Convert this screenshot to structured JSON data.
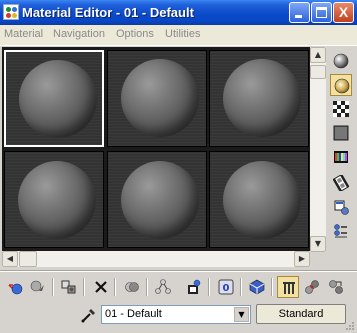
{
  "window": {
    "title": "Material Editor - 01 - Default",
    "minimize_glyph": "_",
    "maximize_glyph": "□",
    "close_glyph": "X"
  },
  "menu": {
    "items": [
      "Material",
      "Navigation",
      "Options",
      "Utilities"
    ],
    "text_color": "#8a8a8a"
  },
  "sample_slots": {
    "count": 6,
    "active_index": 0
  },
  "right_toolbar": {
    "icons": [
      "sample-type-sphere-icon",
      "backlight-icon",
      "background-checker-icon",
      "sample-uv-tiling-icon",
      "video-color-check-icon",
      "make-preview-icon",
      "options-icon",
      "select-by-material-icon"
    ],
    "selected_index": 1
  },
  "bottom_toolbar": {
    "icons": [
      "get-material-icon",
      "put-to-scene-icon",
      "assign-to-selection-icon",
      "reset-material-icon",
      "make-copy-icon",
      "make-unique-icon",
      "put-to-library-icon",
      "material-effects-channel-icon",
      "show-in-viewport-icon",
      "show-end-result-icon",
      "go-to-parent-icon",
      "go-forward-to-sibling-icon"
    ],
    "selected_index": 9
  },
  "material": {
    "name": "01 - Default",
    "type": "Standard"
  },
  "colors": {
    "titlebar": "#0a49c9",
    "window_bg": "#d6d3ce",
    "selected_tool": "#f2e1a0"
  }
}
